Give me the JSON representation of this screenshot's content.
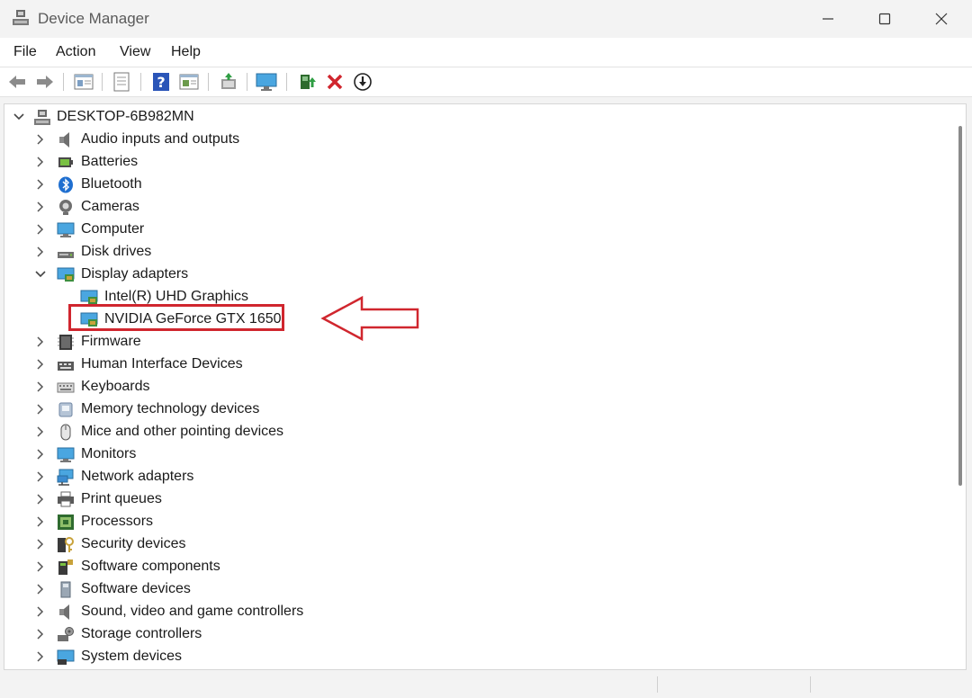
{
  "window": {
    "title": "Device Manager",
    "controls": [
      "minimize",
      "maximize",
      "close"
    ]
  },
  "menu": [
    {
      "label": "File"
    },
    {
      "label": "Action"
    },
    {
      "label": "View"
    },
    {
      "label": "Help"
    }
  ],
  "toolbar": {
    "buttons": [
      {
        "icon": "back-arrow-icon"
      },
      {
        "icon": "forward-arrow-icon"
      },
      {
        "icon": "properties-icon"
      },
      {
        "icon": "properties-sheet-icon"
      },
      {
        "icon": "help-icon"
      },
      {
        "icon": "view-icon"
      },
      {
        "icon": "scan-hardware-icon"
      },
      {
        "icon": "monitor-icon"
      },
      {
        "icon": "update-driver-icon"
      },
      {
        "icon": "uninstall-icon"
      },
      {
        "icon": "disable-device-icon"
      }
    ]
  },
  "tree": {
    "root": "DESKTOP-6B982MN",
    "items": [
      {
        "label": "Audio inputs and outputs",
        "icon": "speaker-icon",
        "expanded": false
      },
      {
        "label": "Batteries",
        "icon": "battery-icon",
        "expanded": false
      },
      {
        "label": "Bluetooth",
        "icon": "bluetooth-icon",
        "expanded": false
      },
      {
        "label": "Cameras",
        "icon": "camera-icon",
        "expanded": false
      },
      {
        "label": "Computer",
        "icon": "computer-icon",
        "expanded": false
      },
      {
        "label": "Disk drives",
        "icon": "disk-drive-icon",
        "expanded": false
      },
      {
        "label": "Display adapters",
        "icon": "display-adapter-icon",
        "expanded": true,
        "children": [
          {
            "label": "Intel(R) UHD Graphics",
            "icon": "display-adapter-icon"
          },
          {
            "label": "NVIDIA GeForce GTX 1650",
            "icon": "display-adapter-icon",
            "highlighted": true
          }
        ]
      },
      {
        "label": "Firmware",
        "icon": "firmware-icon",
        "expanded": false
      },
      {
        "label": "Human Interface Devices",
        "icon": "hid-icon",
        "expanded": false
      },
      {
        "label": "Keyboards",
        "icon": "keyboard-icon",
        "expanded": false
      },
      {
        "label": "Memory technology devices",
        "icon": "memory-icon",
        "expanded": false
      },
      {
        "label": "Mice and other pointing devices",
        "icon": "mouse-icon",
        "expanded": false
      },
      {
        "label": "Monitors",
        "icon": "monitor-icon",
        "expanded": false
      },
      {
        "label": "Network adapters",
        "icon": "network-icon",
        "expanded": false
      },
      {
        "label": "Print queues",
        "icon": "printer-icon",
        "expanded": false
      },
      {
        "label": "Processors",
        "icon": "processor-icon",
        "expanded": false
      },
      {
        "label": "Security devices",
        "icon": "security-icon",
        "expanded": false
      },
      {
        "label": "Software components",
        "icon": "software-component-icon",
        "expanded": false
      },
      {
        "label": "Software devices",
        "icon": "software-device-icon",
        "expanded": false
      },
      {
        "label": "Sound, video and game controllers",
        "icon": "speaker-icon",
        "expanded": false
      },
      {
        "label": "Storage controllers",
        "icon": "storage-icon",
        "expanded": false
      },
      {
        "label": "System devices",
        "icon": "system-icon",
        "expanded": false
      }
    ]
  },
  "colors": {
    "annotation_red": "#d0262e",
    "monitor_blue": "#4aa6e0"
  }
}
